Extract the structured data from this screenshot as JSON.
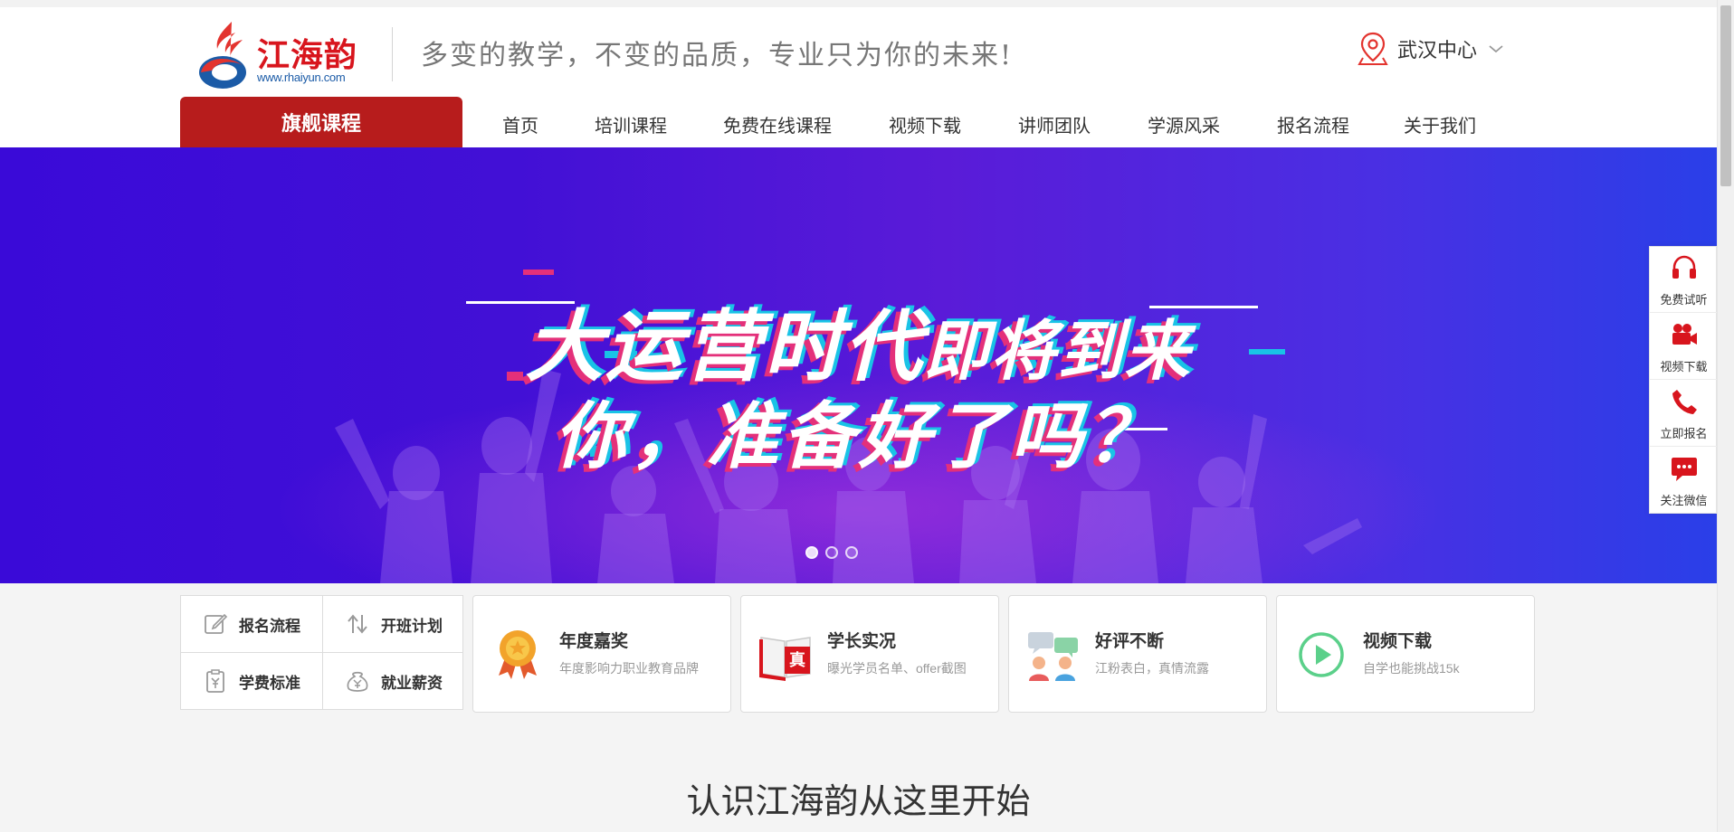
{
  "header": {
    "logo_name": "江海韵",
    "logo_url": "www.rhaiyun.com",
    "slogan": "多变的教学，不变的品质，专业只为你的未来!",
    "location": "武汉中心"
  },
  "nav": {
    "flagship": "旗舰课程",
    "items": [
      "首页",
      "培训课程",
      "免费在线课程",
      "视频下载",
      "讲师团队",
      "学源风采",
      "报名流程",
      "关于我们"
    ]
  },
  "banner": {
    "headline_big": "大运营时代",
    "headline_small": "即将到来",
    "headline_2": "你，准备好了吗？",
    "slides": 3,
    "active_slide": 1
  },
  "quick_links": [
    "报名流程",
    "开班计划",
    "学费标准",
    "就业薪资"
  ],
  "cards": [
    {
      "title": "年度嘉奖",
      "sub": "年度影响力职业教育品牌",
      "icon": "medal-icon"
    },
    {
      "title": "学长实况",
      "sub": "曝光学员名单、offer截图",
      "icon": "book-icon"
    },
    {
      "title": "好评不断",
      "sub": "江粉表白，真情流露",
      "icon": "chat-people-icon"
    },
    {
      "title": "视频下载",
      "sub": "自学也能挑战15k",
      "icon": "play-icon"
    }
  ],
  "card_badge": "真",
  "section_title": "认识江海韵从这里开始",
  "sidebar": [
    "免费试听",
    "视频下载",
    "立即报名",
    "关注微信"
  ],
  "colors": {
    "brand_red": "#b71c1c",
    "logo_red": "#d8151d",
    "logo_blue": "#1b5ba7",
    "banner_purple": "#4210d6",
    "side_icon_red": "#d8151d"
  }
}
